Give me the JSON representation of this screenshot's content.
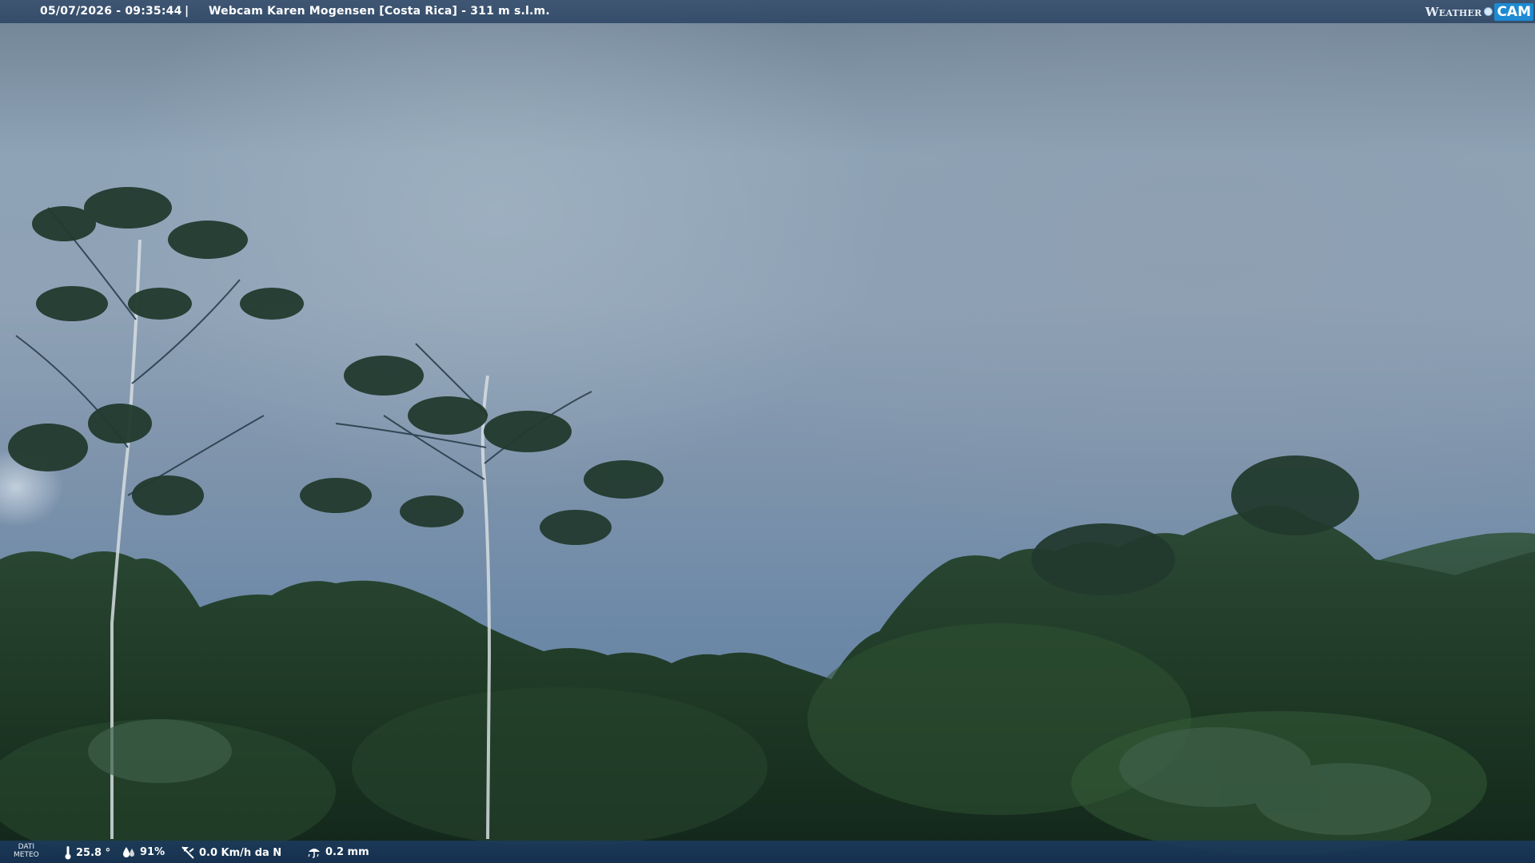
{
  "header": {
    "datetime": "05/07/2026 - 09:35:44",
    "separator": "|",
    "title": "Webcam Karen Mogensen [Costa Rica]  - 311 m s.l.m."
  },
  "logo": {
    "weather": "Weather",
    "cam": "CAM"
  },
  "weather_data": {
    "label_line1": "DATI",
    "label_line2": "METEO",
    "temperature": "25.8 °",
    "humidity": "91%",
    "wind": "0.0 Km/h da N",
    "rain": "0.2 mm",
    "icons": {
      "temperature": "thermometer-icon",
      "humidity": "humidity-drops-icon",
      "wind": "wind-vane-icon",
      "rain": "rain-umbrella-icon"
    }
  },
  "colors": {
    "bar_top": "#3a5270",
    "bar_bottom": "#1c3a5c",
    "logo_accent": "#1d8ad2"
  }
}
